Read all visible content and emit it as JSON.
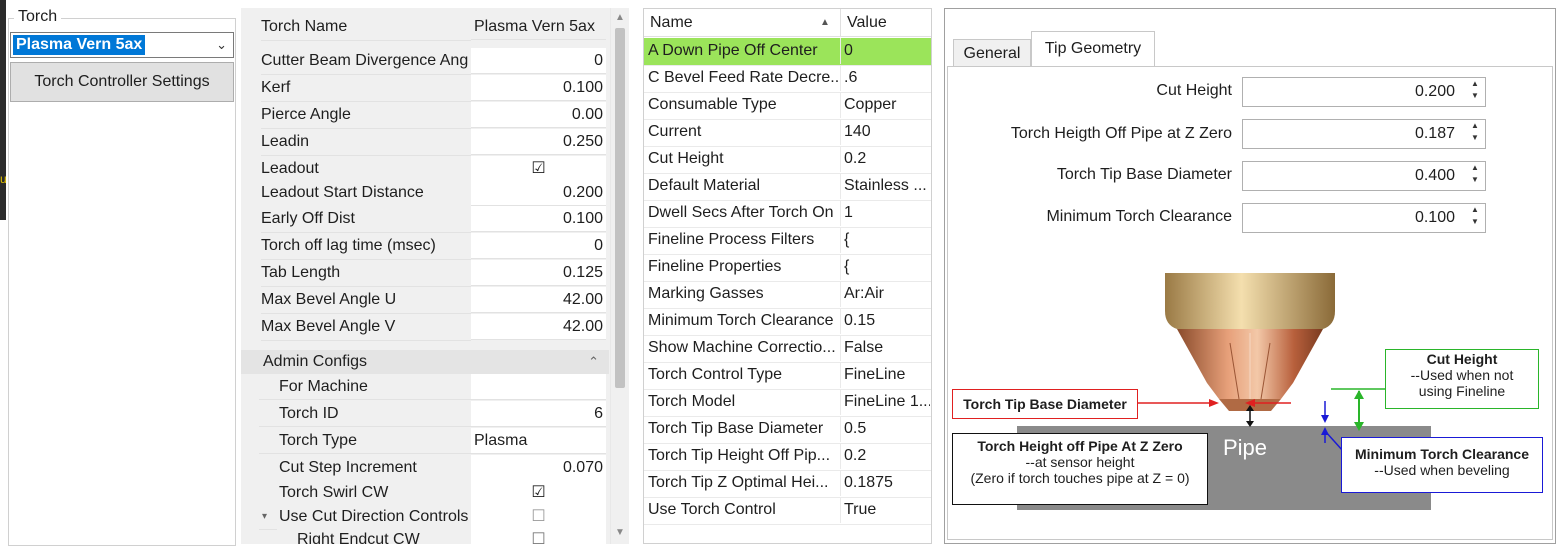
{
  "torch_group": {
    "legend": "Torch",
    "selected": "Plasma Vern 5ax",
    "settings_button": "Torch Controller Settings"
  },
  "grid1": {
    "header": {
      "name": "Torch Name",
      "value": "Plasma Vern 5ax"
    },
    "rows": [
      {
        "name": "Cutter Beam Divergence Ang",
        "value": "0"
      },
      {
        "name": "Kerf",
        "value": "0.100"
      },
      {
        "name": "Pierce Angle",
        "value": "0.00"
      },
      {
        "name": "Leadin",
        "value": "0.250"
      },
      {
        "name": "Leadout",
        "value": "☑"
      },
      {
        "name": "Leadout Start Distance",
        "value": "0.200"
      },
      {
        "name": "Early Off Dist",
        "value": "0.100"
      },
      {
        "name": "Torch off lag time (msec)",
        "value": "0"
      },
      {
        "name": "Tab Length",
        "value": "0.125"
      },
      {
        "name": "Max Bevel Angle U",
        "value": "42.00"
      },
      {
        "name": "Max Bevel Angle V",
        "value": "42.00"
      }
    ],
    "category": "Admin Configs",
    "sub_rows": [
      {
        "name": "For Machine",
        "value": ""
      },
      {
        "name": "Torch ID",
        "value": "6"
      },
      {
        "name": "Torch Type",
        "value": "Plasma"
      },
      {
        "name": "Cut Step Increment",
        "value": "0.070"
      },
      {
        "name": "Torch Swirl CW",
        "value": "☑"
      },
      {
        "name": "Use Cut Direction Controls",
        "value": "☐"
      },
      {
        "name": "Right Endcut CW",
        "value": "☐"
      }
    ]
  },
  "grid2": {
    "col_name": "Name",
    "col_value": "Value",
    "rows": [
      {
        "name": "A Down Pipe Off Center",
        "value": "0"
      },
      {
        "name": "C Bevel Feed Rate Decre...",
        "value": ".6"
      },
      {
        "name": "Consumable Type",
        "value": "Copper"
      },
      {
        "name": "Current",
        "value": "140"
      },
      {
        "name": "Cut Height",
        "value": "0.2"
      },
      {
        "name": "Default Material",
        "value": "Stainless ..."
      },
      {
        "name": "Dwell Secs After Torch On",
        "value": "1"
      },
      {
        "name": "Fineline Process Filters",
        "value": "{"
      },
      {
        "name": "Fineline Properties",
        "value": "{"
      },
      {
        "name": "Marking Gasses",
        "value": "Ar:Air"
      },
      {
        "name": "Minimum Torch Clearance",
        "value": "0.15"
      },
      {
        "name": "Show Machine Correctio...",
        "value": "False"
      },
      {
        "name": "Torch Control Type",
        "value": "FineLine"
      },
      {
        "name": "Torch Model",
        "value": "FineLine 1..."
      },
      {
        "name": "Torch Tip Base Diameter",
        "value": "0.5"
      },
      {
        "name": "Torch Tip Height Off Pip...",
        "value": "0.2"
      },
      {
        "name": "Torch Tip Z Optimal Hei...",
        "value": "0.1875"
      },
      {
        "name": "Use Torch Control",
        "value": "True"
      }
    ]
  },
  "tabs": {
    "general": "General",
    "tip_geometry": "Tip Geometry"
  },
  "fields": [
    {
      "label": "Cut Height",
      "value": "0.200"
    },
    {
      "label": "Torch Heigth Off Pipe at Z Zero",
      "value": "0.187"
    },
    {
      "label": "Torch Tip Base Diameter",
      "value": "0.400"
    },
    {
      "label": "Minimum Torch Clearance",
      "value": "0.100"
    }
  ],
  "illustration": {
    "pipe": "Pipe",
    "tip_base": "Torch Tip Base Diameter",
    "cut_height_title": "Cut Height",
    "cut_height_sub1": "--Used when not",
    "cut_height_sub2": "using Fineline",
    "height_title": "Torch Height off Pipe At Z Zero",
    "height_sub1": "--at sensor height",
    "height_sub2": "(Zero if torch touches pipe at Z = 0)",
    "min_title": "Minimum Torch Clearance",
    "min_sub": "--Used when beveling",
    "colors": {
      "red": "#e02020",
      "green": "#2ab52a",
      "blue": "#1a1ad6",
      "black": "#111111"
    }
  }
}
